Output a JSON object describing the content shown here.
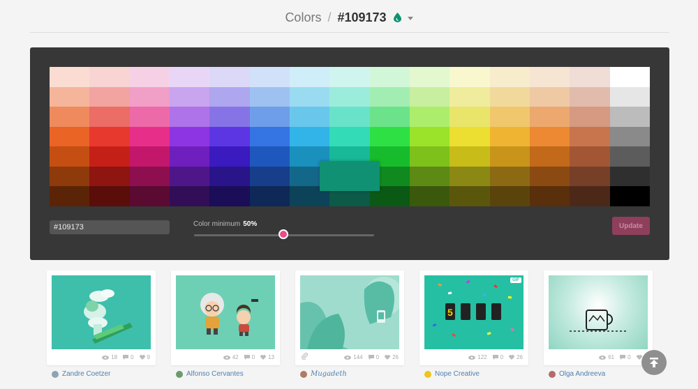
{
  "header": {
    "crumb": "Colors",
    "separator": "/",
    "hex": "#109173",
    "drop_icon": "drop-icon",
    "caret_icon": "caret-down-icon"
  },
  "palette": {
    "columns": 15,
    "rows": 7,
    "colors": [
      [
        "#fbdcd2",
        "#f8d4d3",
        "#f6d1e6",
        "#e9d6f7",
        "#dcd8f7",
        "#d2e1fa",
        "#d0eef9",
        "#cff5ee",
        "#d2f7d8",
        "#e3f8cf",
        "#f8f7cd",
        "#f7edcd",
        "#f6e5d2",
        "#f0ddd6",
        "#ffffff"
      ],
      [
        "#f4b59a",
        "#f2a4a1",
        "#f19fc7",
        "#c9a4ef",
        "#aea6ef",
        "#9fc1f1",
        "#9adbf1",
        "#9cecdc",
        "#a2edb2",
        "#c7ef9f",
        "#efec9d",
        "#f1d99c",
        "#eec9a4",
        "#e1bcac",
        "#e6e6e6"
      ],
      [
        "#ef8a5c",
        "#ec6c66",
        "#ed6aa9",
        "#ae73e8",
        "#8674e6",
        "#6e9ee9",
        "#6ac7ec",
        "#68e3c9",
        "#6ce38a",
        "#acee6c",
        "#e8e56a",
        "#f0c76d",
        "#eca86f",
        "#d59a81",
        "#bcbcbc"
      ],
      [
        "#ea6426",
        "#e8392f",
        "#e72f8a",
        "#8d35e3",
        "#5c36e3",
        "#3574e3",
        "#32b4e8",
        "#33dbb7",
        "#2ee044",
        "#9ae32a",
        "#ecdf31",
        "#efb432",
        "#ec8932",
        "#c8754e",
        "#8a8a8a"
      ],
      [
        "#c54f12",
        "#c52018",
        "#c3176c",
        "#6e1fbd",
        "#3b1abf",
        "#1f58bd",
        "#1a90bd",
        "#17b998",
        "#17bc2d",
        "#7ec11b",
        "#c8bc19",
        "#c8941a",
        "#c3691a",
        "#a25634",
        "#5c5c5c"
      ],
      [
        "#8e3a0b",
        "#8e1510",
        "#8e0f4f",
        "#4f168a",
        "#2a148a",
        "#163e8a",
        "#13688a",
        "#109173",
        "#108a1f",
        "#5c8a14",
        "#8c8814",
        "#8c6a13",
        "#8c4a13",
        "#763f27",
        "#2f2f2f"
      ],
      [
        "#5b2406",
        "#5b0d09",
        "#5b0a32",
        "#320e58",
        "#1b0d58",
        "#0e2858",
        "#0c4358",
        "#0c5a48",
        "#0a5914",
        "#3b590c",
        "#5a570c",
        "#5a440c",
        "#5a2f0c",
        "#4c2818",
        "#000000"
      ]
    ],
    "selected": "#109173"
  },
  "controls": {
    "hex_value": "#109173",
    "min_label": "Color minimum",
    "min_value": "50%",
    "slider_value": 50,
    "update_label": "Update"
  },
  "shots": [
    {
      "views": "18",
      "comments": "0",
      "likes": "9",
      "owner": "Zandre Coetzer",
      "bg": "#3dbfab"
    },
    {
      "views": "42",
      "comments": "0",
      "likes": "13",
      "owner": "Alfonso Cervantes",
      "bg": "#6dd0b4"
    },
    {
      "views": "144",
      "comments": "0",
      "likes": "26",
      "owner": "Mugadeth",
      "bg": "#9fdccd"
    },
    {
      "views": "122",
      "comments": "0",
      "likes": "26",
      "owner": "Nope Creative",
      "bg": "#25c0a3",
      "badge": "GIF"
    },
    {
      "views": "61",
      "comments": "0",
      "likes": "0",
      "owner": "Olga Andreeva",
      "bg": "#8fd5c2"
    }
  ],
  "back_to_top_icon": "arrow-up-icon"
}
